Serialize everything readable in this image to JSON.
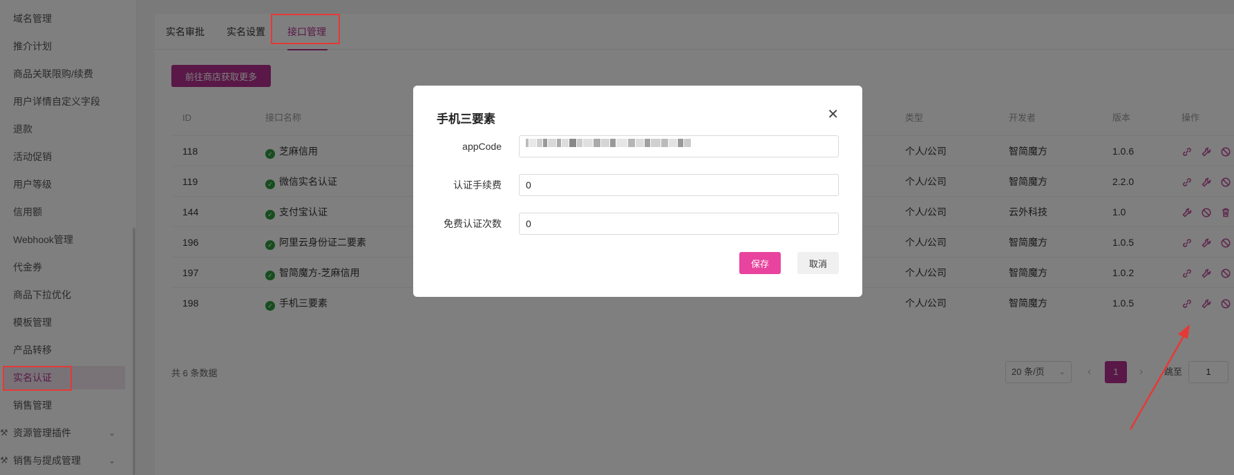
{
  "sidebar": {
    "items": [
      {
        "label": "域名管理"
      },
      {
        "label": "推介计划"
      },
      {
        "label": "商品关联限购/续费"
      },
      {
        "label": "用户详情自定义字段"
      },
      {
        "label": "退款"
      },
      {
        "label": "活动促销"
      },
      {
        "label": "用户等级"
      },
      {
        "label": "信用额"
      },
      {
        "label": "Webhook管理"
      },
      {
        "label": "代金券"
      },
      {
        "label": "商品下拉优化"
      },
      {
        "label": "模板管理"
      },
      {
        "label": "产品转移"
      },
      {
        "label": "实名认证",
        "active": true
      },
      {
        "label": "销售管理"
      },
      {
        "label": "资源管理插件",
        "icon": "plugin-icon",
        "expandable": true
      },
      {
        "label": "销售与提成管理",
        "icon": "plugin-icon",
        "expandable": true
      }
    ]
  },
  "tabs": [
    {
      "label": "实名审批"
    },
    {
      "label": "实名设置"
    },
    {
      "label": "接口管理",
      "active": true
    }
  ],
  "shop_button": "前往商店获取更多",
  "table": {
    "headers": {
      "id": "ID",
      "name": "接口名称",
      "type": "类型",
      "developer": "开发者",
      "version": "版本",
      "ops": "操作"
    },
    "rows": [
      {
        "id": "118",
        "name": "芝麻信用",
        "type": "个人/公司",
        "developer": "智简魔方",
        "version": "1.0.6",
        "ops": [
          "link-icon",
          "wrench-icon",
          "disable-icon",
          "delete-icon"
        ]
      },
      {
        "id": "119",
        "name": "微信实名认证",
        "type": "个人/公司",
        "developer": "智简魔方",
        "version": "2.2.0",
        "ops": [
          "link-icon",
          "wrench-icon",
          "disable-icon",
          "delete-icon"
        ]
      },
      {
        "id": "144",
        "name": "支付宝认证",
        "type": "个人/公司",
        "developer": "云外科技",
        "version": "1.0",
        "ops": [
          "wrench-icon",
          "disable-icon",
          "delete-icon"
        ]
      },
      {
        "id": "196",
        "name": "阿里云身份证二要素",
        "type": "个人/公司",
        "developer": "智简魔方",
        "version": "1.0.5",
        "ops": [
          "link-icon",
          "wrench-icon",
          "disable-icon",
          "delete-icon"
        ]
      },
      {
        "id": "197",
        "name": "智简魔方-芝麻信用",
        "type": "个人/公司",
        "developer": "智简魔方",
        "version": "1.0.2",
        "ops": [
          "link-icon",
          "wrench-icon",
          "disable-icon",
          "delete-icon"
        ]
      },
      {
        "id": "198",
        "name": "手机三要素",
        "type": "个人/公司",
        "developer": "智简魔方",
        "version": "1.0.5",
        "ops": [
          "link-icon",
          "wrench-icon",
          "disable-icon",
          "delete-icon"
        ]
      }
    ]
  },
  "pagination": {
    "total": "共 6 条数据",
    "page_size": "20 条/页",
    "current_page": "1",
    "goto_label": "跳至",
    "goto_value": "1"
  },
  "modal": {
    "title": "手机三要素",
    "fields": [
      {
        "label": "appCode",
        "value": ""
      },
      {
        "label": "认证手续费",
        "value": "0"
      },
      {
        "label": "免费认证次数",
        "value": "0"
      }
    ],
    "save": "保存",
    "cancel": "取消"
  },
  "colors": {
    "accent": "#b2308f",
    "save_button": "#e8439e",
    "annotation": "#e53935",
    "status_ok": "#2e9b3e"
  }
}
